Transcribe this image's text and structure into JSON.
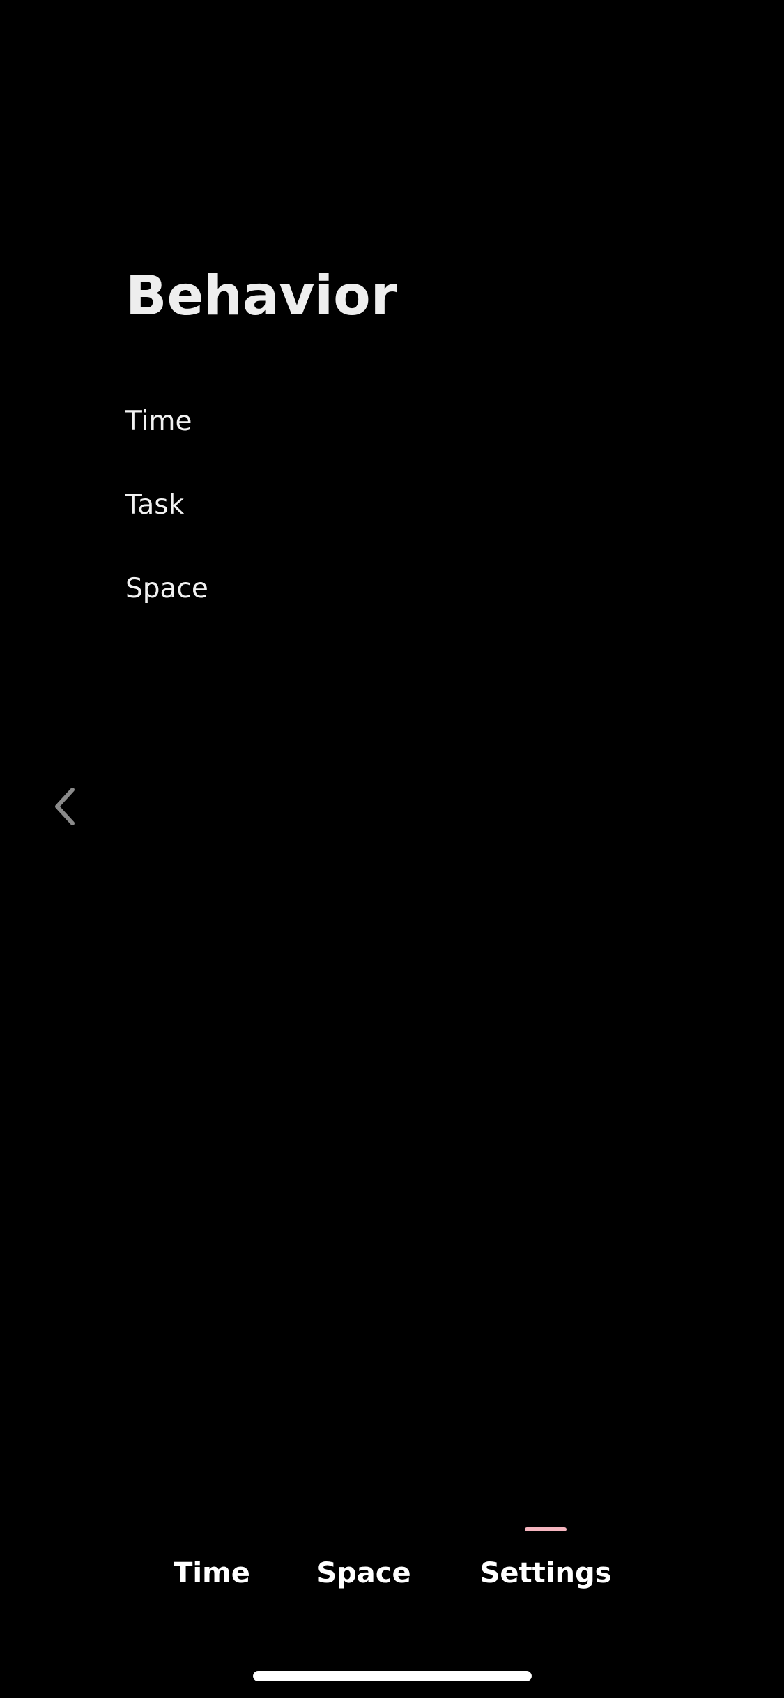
{
  "page": {
    "title": "Behavior"
  },
  "menu": {
    "items": [
      {
        "label": "Time"
      },
      {
        "label": "Task"
      },
      {
        "label": "Space"
      }
    ]
  },
  "navigation": {
    "back_icon": "chevron-left-icon"
  },
  "tab_bar": {
    "tabs": [
      {
        "label": "Time",
        "active": false
      },
      {
        "label": "Space",
        "active": false
      },
      {
        "label": "Settings",
        "active": true
      }
    ],
    "active_indicator_color": "#f5b5bf"
  },
  "colors": {
    "background": "#000000",
    "text": "#ffffff",
    "title": "#eeeeee",
    "back_icon": "#8a8a8a"
  }
}
